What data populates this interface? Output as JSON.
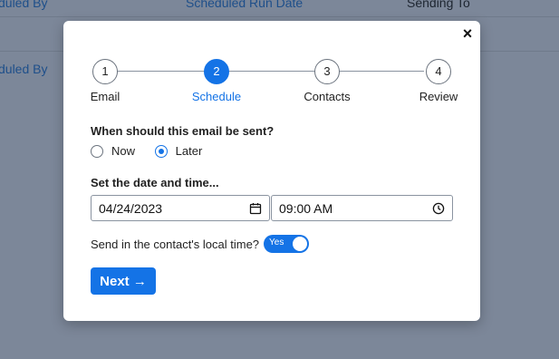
{
  "background": {
    "row1": [
      "duled By",
      "Scheduled Run Date",
      "Sending To"
    ],
    "row2": [
      "duled By"
    ]
  },
  "modal": {
    "close_label": "×",
    "steps": [
      {
        "number": "1",
        "label": "Email",
        "active": false
      },
      {
        "number": "2",
        "label": "Schedule",
        "active": true
      },
      {
        "number": "3",
        "label": "Contacts",
        "active": false
      },
      {
        "number": "4",
        "label": "Review",
        "active": false
      }
    ],
    "when_question": "When should this email be sent?",
    "options": [
      {
        "label": "Now",
        "checked": false
      },
      {
        "label": "Later",
        "checked": true
      }
    ],
    "datetime_heading": "Set the date and time...",
    "date_value": "04/24/2023",
    "time_value": "09:00 AM",
    "local_time_label": "Send in the contact's local time?",
    "toggle_label": "Yes",
    "next_label": "Next →"
  },
  "colors": {
    "accent": "#1473e6",
    "overlay": "#7c8799"
  }
}
